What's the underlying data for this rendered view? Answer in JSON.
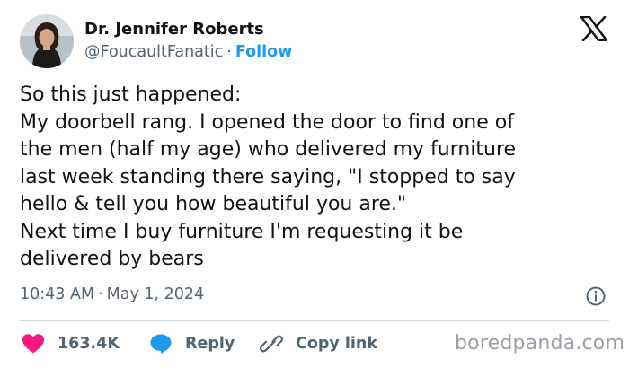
{
  "author": {
    "name": "Dr. Jennifer Roberts",
    "handle": "@FoucaultFanatic",
    "separator": "·",
    "follow_label": "Follow"
  },
  "tweet": {
    "lines": [
      "So this just happened:",
      "My doorbell rang. I opened the door to find one of",
      "the men (half my age) who delivered my furniture",
      "last week standing there saying, \"I stopped to say",
      "hello & tell you how beautiful you are.\"",
      "Next time I buy furniture I'm requesting it be",
      "delivered by bears"
    ]
  },
  "meta": {
    "time": "10:43 AM",
    "separator": "·",
    "date": "May 1, 2024"
  },
  "actions": {
    "like_count": "163.4K",
    "reply_label": "Reply",
    "copy_link_label": "Copy link"
  },
  "watermark": "boredpanda.com",
  "icons": {
    "logo": "x-logo-icon",
    "info": "info-icon",
    "like": "heart-icon",
    "reply": "speech-bubble-icon",
    "copy": "link-icon"
  },
  "colors": {
    "text": "#0f1419",
    "secondary": "#536471",
    "accent": "#1d9bf0",
    "like": "#f91880",
    "divider": "#cfd9de"
  }
}
